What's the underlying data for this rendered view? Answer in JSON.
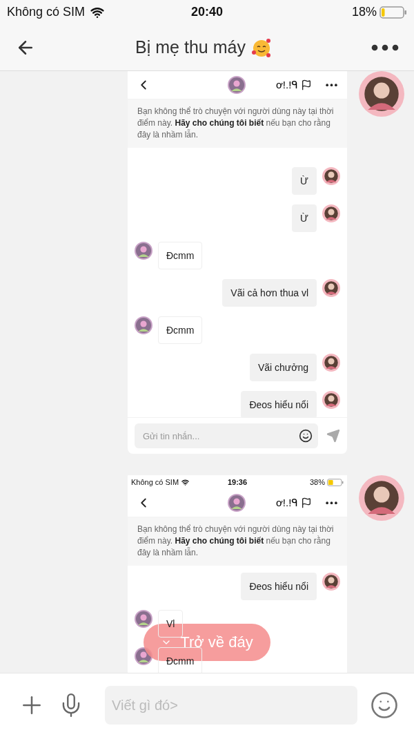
{
  "status_bar": {
    "carrier": "Không có SIM",
    "time": "20:40",
    "battery": "18%"
  },
  "header": {
    "title": "Bị mẹ thu máy"
  },
  "messages": [
    {
      "kind": "image",
      "shot": {
        "contact_name": "ơ!.!ᑫ",
        "notice": "Bạn không thể trò chuyện với người dùng này tại thời điểm này. **Hãy cho chúng tôi biết** nếu bạn cho rằng đây là nhầm lẫn.",
        "messages": [
          {
            "kind": "sent",
            "text": "Ừ"
          },
          {
            "kind": "sent",
            "text": "Ừ"
          },
          {
            "kind": "received",
            "text": "Đcmm"
          },
          {
            "kind": "sent",
            "text": "Vãi cả hơn thua vl"
          },
          {
            "kind": "received",
            "text": "Đcmm"
          },
          {
            "kind": "sent",
            "text": "Vãi chưởng"
          },
          {
            "kind": "sent",
            "text": "Đeos hiểu nổi"
          }
        ],
        "composer": {
          "placeholder": "Gửi tin nhắn..."
        }
      }
    },
    {
      "kind": "image",
      "shot": {
        "status_bar": {
          "carrier": "Không có SIM",
          "time": "19:36",
          "battery": "38%"
        },
        "contact_name": "ơ!.!ᑫ",
        "notice": "Bạn không thể trò chuyện với người dùng này tại thời điểm này. **Hãy cho chúng tôi biết** nếu bạn cho rằng đây là nhầm lẫn.",
        "messages": [
          {
            "kind": "sent",
            "text": "Đeos hiểu nổi"
          },
          {
            "kind": "received",
            "text": "Vl"
          },
          {
            "kind": "received",
            "text": "Đcmm"
          }
        ]
      }
    }
  ],
  "scroll_button": {
    "label": "Trở về đáy"
  },
  "composer": {
    "placeholder": "Viết gì đó>"
  }
}
